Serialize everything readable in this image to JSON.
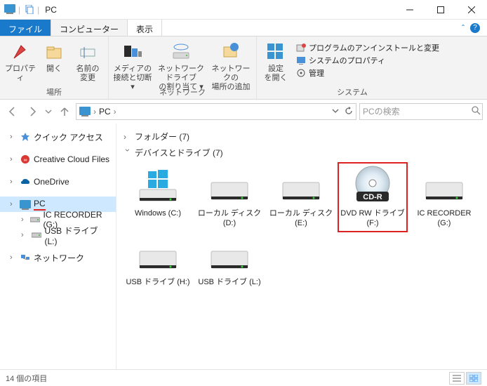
{
  "window": {
    "title": "PC"
  },
  "tabs": {
    "file": "ファイル",
    "computer": "コンピューター",
    "view": "表示"
  },
  "ribbon": {
    "group_location": "場所",
    "group_network": "ネットワーク",
    "group_system": "システム",
    "properties": "プロパティ",
    "open": "開く",
    "rename": "名前の\n変更",
    "media": "メディアの\n接続と切断 ▾",
    "map_drive": "ネットワーク ドライブ\nの割り当て ▾",
    "add_location": "ネットワークの\n場所の追加",
    "settings": "設定\nを開く",
    "uninstall": "プログラムのアンインストールと変更",
    "sys_props": "システムのプロパティ",
    "manage": "管理"
  },
  "address": {
    "root": "PC",
    "sep": "›"
  },
  "search": {
    "placeholder": "PCの検索"
  },
  "nav": {
    "quick": "クイック アクセス",
    "ccf": "Creative Cloud Files",
    "onedrive": "OneDrive",
    "pc": "PC",
    "icrec": "IC RECORDER (G:)",
    "usb": "USB ドライブ (L:)",
    "network": "ネットワーク"
  },
  "sections": {
    "folders": "フォルダー (7)",
    "devices": "デバイスとドライブ (7)"
  },
  "drives": [
    {
      "label": "Windows (C:)",
      "type": "os"
    },
    {
      "label": "ローカル ディスク (D:)",
      "type": "hdd"
    },
    {
      "label": "ローカル ディスク (E:)",
      "type": "hdd"
    },
    {
      "label": "DVD RW ドライブ (F:)",
      "type": "dvd",
      "badge": "CD-R",
      "highlight": true
    },
    {
      "label": "IC RECORDER (G:)",
      "type": "hdd"
    },
    {
      "label": "USB ドライブ (H:)",
      "type": "hdd"
    },
    {
      "label": "USB ドライブ (L:)",
      "type": "hdd"
    }
  ],
  "status": {
    "items": "14 個の項目"
  }
}
